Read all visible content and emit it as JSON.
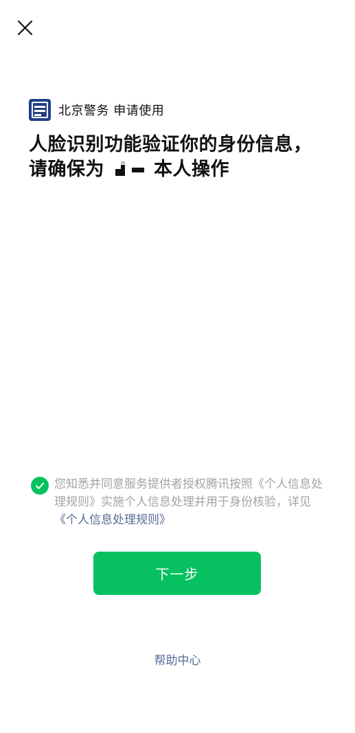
{
  "header": {
    "close_icon": "close-icon"
  },
  "app": {
    "logo_icon": "police-badge-logo",
    "name": "北京警务",
    "request_text": "申请使用"
  },
  "title": {
    "line1": "人脸识别功能验证你的身份信息，",
    "line2_prefix": "请确保为",
    "line2_suffix": "本人操作"
  },
  "consent": {
    "checked": true,
    "text_part1": "您知悉并同意服务提供者授权腾讯按照《个人信息处理规则》实施个人信息处理并用于身份核验，详见",
    "link_text": "《个人信息处理规则》"
  },
  "actions": {
    "next_label": "下一步"
  },
  "footer": {
    "help_label": "帮助中心"
  },
  "colors": {
    "primary_green": "#07c160",
    "link_blue": "#576b95",
    "muted_gray": "#a3a3a3"
  }
}
